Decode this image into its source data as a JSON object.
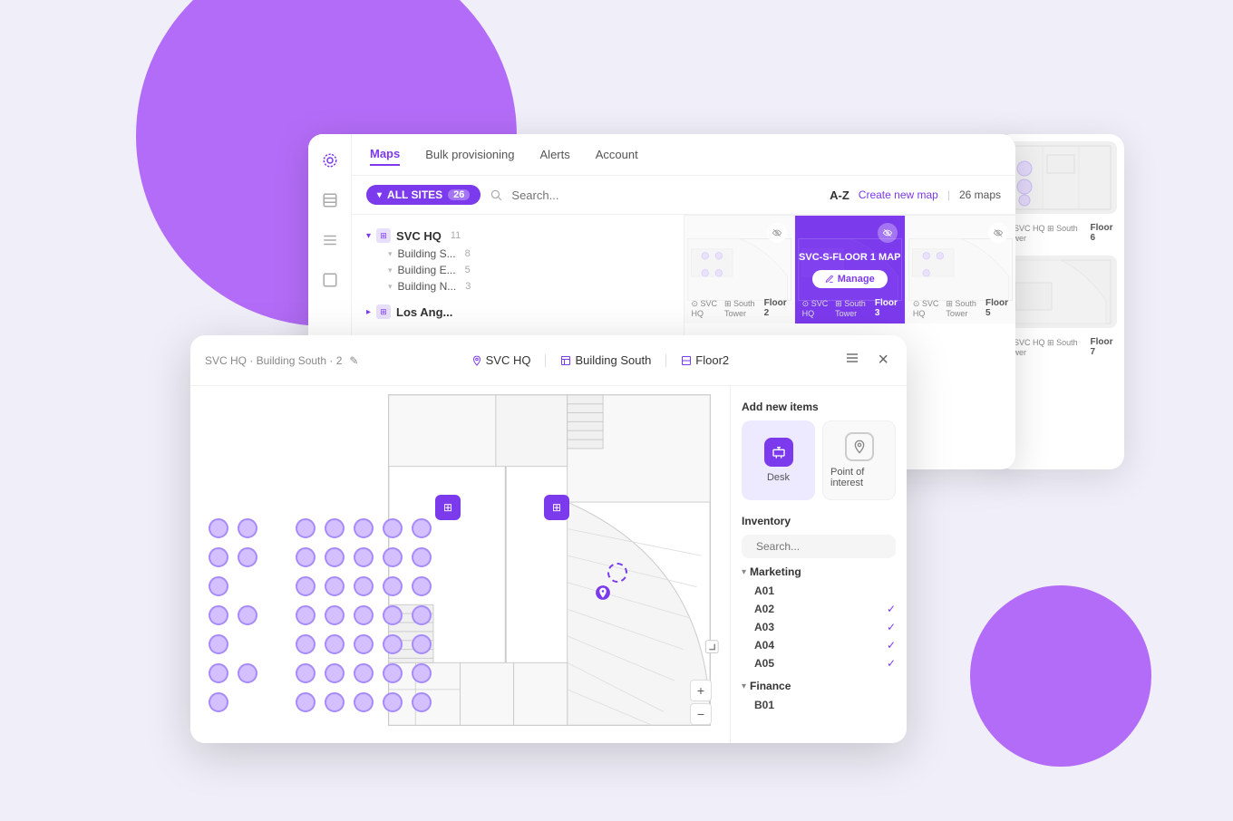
{
  "background": {
    "circle_top_color": "#a855f7",
    "circle_bottom_color": "#a855f7"
  },
  "maps_card": {
    "nav": {
      "items": [
        "Maps",
        "Bulk provisioning",
        "Alerts",
        "Account"
      ],
      "active": "Maps"
    },
    "filter_bar": {
      "all_sites_label": "ALL SITES",
      "count": "26",
      "az_label": "A-Z",
      "create_new_label": "Create new map",
      "maps_count_label": "26 maps"
    },
    "tree": {
      "sites": [
        {
          "name": "SVC HQ",
          "count": "11",
          "buildings": [
            {
              "name": "Building S...",
              "count": "8"
            },
            {
              "name": "Building E...",
              "count": "5"
            },
            {
              "name": "Building N...",
              "count": "3"
            }
          ]
        },
        {
          "name": "Los Ang...",
          "count": "",
          "buildings": []
        }
      ]
    },
    "map_cards": [
      {
        "floor_label": "Floor 2",
        "location1": "SVC HQ",
        "location2": "South Tower",
        "highlighted": false
      },
      {
        "floor_label": "Floor 3",
        "location1": "SVC HQ",
        "location2": "South Tower",
        "highlighted": true,
        "overlay_title": "SVC-S-FLOOR 1 MAP",
        "manage_label": "Manage"
      },
      {
        "floor_label": "Floor 5",
        "location1": "SVC HQ",
        "location2": "South Tower",
        "highlighted": false
      }
    ]
  },
  "floor_card": {
    "header": {
      "breadcrumb": "SVC HQ · Building South · 2",
      "edit_icon": "✎",
      "site_label": "SVC HQ",
      "building_label": "Building South",
      "floor_label": "Floor2",
      "list_icon": "≡",
      "close_icon": "×"
    },
    "right_panel": {
      "add_items_title": "Add new items",
      "add_items": [
        {
          "label": "Desk",
          "active": true
        },
        {
          "label": "Point of interest",
          "active": false
        }
      ],
      "inventory_title": "Inventory",
      "search_placeholder": "Search...",
      "groups": [
        {
          "name": "Marketing",
          "items": [
            {
              "name": "A01",
              "checked": false
            },
            {
              "name": "A02",
              "checked": true
            },
            {
              "name": "A03",
              "checked": true
            },
            {
              "name": "A04",
              "checked": true
            },
            {
              "name": "A05",
              "checked": true
            }
          ]
        },
        {
          "name": "Finance",
          "items": [
            {
              "name": "B01",
              "checked": false
            }
          ]
        }
      ]
    },
    "zoom": {
      "plus": "+",
      "minus": "−"
    }
  },
  "sidebar_icons": [
    "⊙",
    "□",
    "≡",
    "□"
  ]
}
